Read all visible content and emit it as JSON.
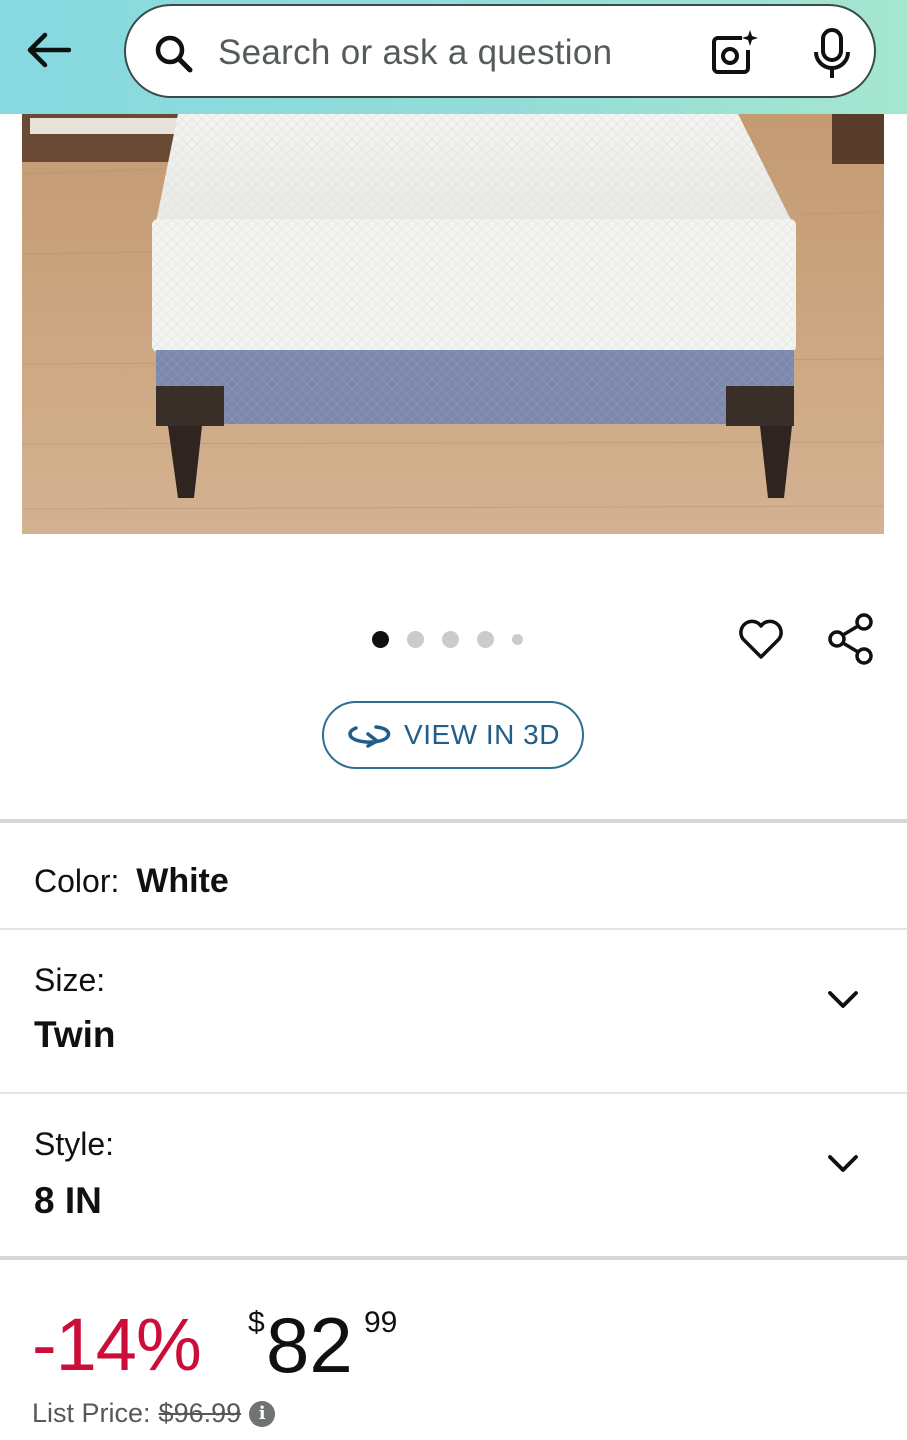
{
  "header": {
    "search_placeholder": "Search or ask a question",
    "icons": [
      "back-arrow-icon",
      "search-icon",
      "camera-lens-icon",
      "microphone-icon"
    ]
  },
  "gallery": {
    "image_description": "mattress-on-bed-frame",
    "dot_count": 5,
    "active_index": 0,
    "view3d_label": "VIEW IN 3D"
  },
  "variations": {
    "color_label": "Color:",
    "color_value": "White",
    "size_label": "Size:",
    "size_value": "Twin",
    "style_label": "Style:",
    "style_value": "8 IN"
  },
  "price": {
    "discount": "-14%",
    "currency": "$",
    "whole": "82",
    "fraction": "99",
    "list_label": "List Price:",
    "list_value": "$96.99"
  },
  "colors": {
    "header_gradient_start": "#86d9e0",
    "header_gradient_end": "#a5e6cf",
    "discount_red": "#cc0c39",
    "link_blue": "#1f5d8a"
  }
}
